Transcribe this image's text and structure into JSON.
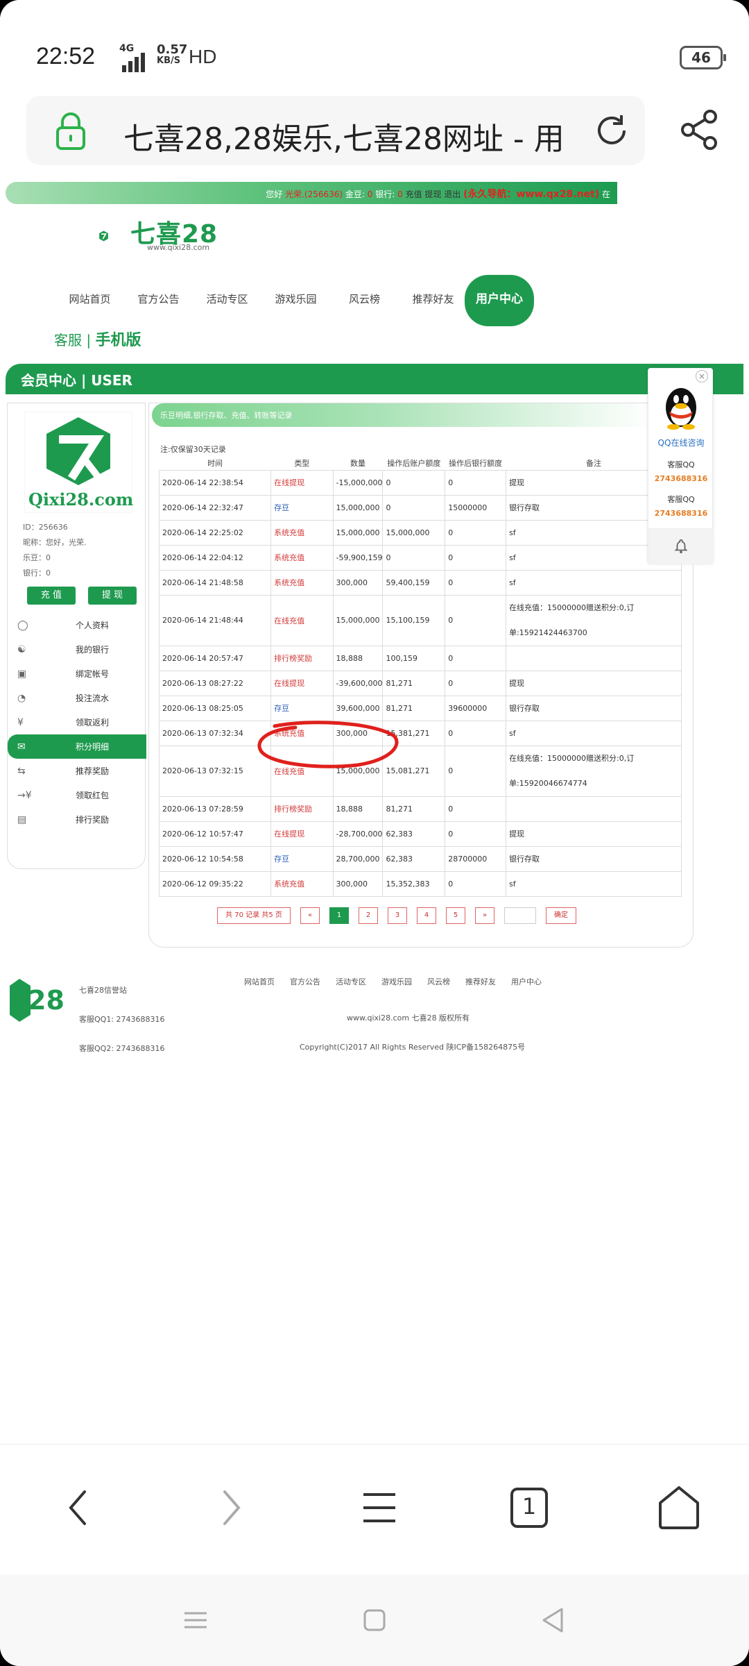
{
  "status": {
    "time": "22:52",
    "net": "4G",
    "speed_top": "0.57",
    "speed_bottom": "KB/S",
    "hd": "HD",
    "battery": "46"
  },
  "browser": {
    "url_title": "七喜28,28娱乐,七喜28网址 - 用"
  },
  "site": {
    "topbar": {
      "greeting": "您好",
      "user": "光荣.(256636)",
      "bean_label": "金豆:",
      "bean_value": "0",
      "bank_label": "银行:",
      "bank_value": "0",
      "recharge": "充值",
      "withdraw": "提现",
      "logout": "退出",
      "permanent_nav": "(永久导航：www.qx28.net)",
      "trailing": "在"
    },
    "logo_text": "七喜28",
    "logo_url": "www.qixi28.com",
    "nav": [
      "网站首页",
      "官方公告",
      "活动专区",
      "游戏乐园",
      "风云榜",
      "推荐好友",
      "用户中心"
    ],
    "kefu": "客服",
    "mobile": "手机版",
    "user_center_title": "会员中心 | USER"
  },
  "sidebar": {
    "logo_text": "Qixi28.com",
    "info": [
      "ID：256636",
      "昵称：您好，光荣.",
      "乐豆：0",
      "银行：0"
    ],
    "btn_recharge": "充 值",
    "btn_withdraw": "提 现",
    "menu": [
      {
        "icon": "person-icon",
        "label": "个人资料"
      },
      {
        "icon": "bank-icon",
        "label": "我的银行"
      },
      {
        "icon": "bind-icon",
        "label": "绑定帐号"
      },
      {
        "icon": "betflow-icon",
        "label": "投注流水"
      },
      {
        "icon": "rebate-icon",
        "label": "领取返利"
      },
      {
        "icon": "chat-icon",
        "label": "积分明细"
      },
      {
        "icon": "transfer-icon",
        "label": "推荐奖励"
      },
      {
        "icon": "redpacket-icon",
        "label": "领取红包"
      },
      {
        "icon": "rank-icon",
        "label": "排行奖励"
      }
    ]
  },
  "panel": {
    "strip": "乐豆明细,银行存取、充值、转账等记录",
    "note": "注:仅保留30天记录",
    "headers": [
      "时间",
      "类型",
      "数量",
      "操作后账户额度",
      "操作后银行额度",
      "备注"
    ],
    "rows": [
      [
        "2020-06-14 22:38:54",
        "在线提现",
        "-15,000,000",
        "0",
        "0",
        "提现"
      ],
      [
        "2020-06-14 22:32:47",
        "存豆",
        "15,000,000",
        "0",
        "15000000",
        "银行存取"
      ],
      [
        "2020-06-14 22:25:02",
        "系统充值",
        "15,000,000",
        "15,000,000",
        "0",
        "sf"
      ],
      [
        "2020-06-14 22:04:12",
        "系统充值",
        "-59,900,159",
        "0",
        "0",
        "sf"
      ],
      [
        "2020-06-14 21:48:58",
        "系统充值",
        "300,000",
        "59,400,159",
        "0",
        "sf"
      ],
      [
        "2020-06-14 21:48:44",
        "在线充值",
        "15,000,000",
        "15,100,159",
        "0",
        "在线充值：15000000赠送积分:0,订单:15921424463700"
      ],
      [
        "2020-06-14 20:57:47",
        "排行榜奖励",
        "18,888",
        "100,159",
        "0",
        ""
      ],
      [
        "2020-06-13 08:27:22",
        "在线提现",
        "-39,600,000",
        "81,271",
        "0",
        "提现"
      ],
      [
        "2020-06-13 08:25:05",
        "存豆",
        "39,600,000",
        "81,271",
        "39600000",
        "银行存取"
      ],
      [
        "2020-06-13 07:32:34",
        "系统充值",
        "300,000",
        "15,381,271",
        "0",
        "sf"
      ],
      [
        "2020-06-13 07:32:15",
        "在线充值",
        "15,000,000",
        "15,081,271",
        "0",
        "在线充值：15000000赠送积分:0,订单:15920046674774"
      ],
      [
        "2020-06-13 07:28:59",
        "排行榜奖励",
        "18,888",
        "81,271",
        "0",
        ""
      ],
      [
        "2020-06-12 10:57:47",
        "在线提现",
        "-28,700,000",
        "62,383",
        "0",
        "提现"
      ],
      [
        "2020-06-12 10:54:58",
        "存豆",
        "28,700,000",
        "62,383",
        "28700000",
        "银行存取"
      ],
      [
        "2020-06-12 09:35:22",
        "系统充值",
        "300,000",
        "15,352,383",
        "0",
        "sf"
      ]
    ],
    "pager": {
      "summary": "共 70 记录 共5 页",
      "prev": "«",
      "pages": [
        "1",
        "2",
        "3",
        "4",
        "5"
      ],
      "next": "»",
      "go": "确定"
    }
  },
  "qq": {
    "close": "×",
    "title": "QQ在线咨询",
    "label1": "客服QQ",
    "num1": "2743688316",
    "label2": "客服QQ",
    "num2": "2743688316"
  },
  "footer": {
    "site_name": "七喜28信誉站",
    "qq1": "客服QQ1: 2743688316",
    "qq2": "客服QQ2: 2743688316",
    "nav": [
      "网站首页",
      "官方公告",
      "活动专区",
      "游戏乐园",
      "风云榜",
      "推荐好友",
      "用户中心"
    ],
    "copy1": "www.qixi28.com 七喜28 版权所有",
    "copy2": "Copyright(C)2017 All Rights Reserved  陕ICP备158264875号"
  },
  "bottombar": {
    "tab_count": "1"
  },
  "colors": {
    "brand_green": "#1e9a4f",
    "red_text": "#d23a3a",
    "blue_text": "#2b5fb8",
    "annotation_red": "#e0201c"
  }
}
